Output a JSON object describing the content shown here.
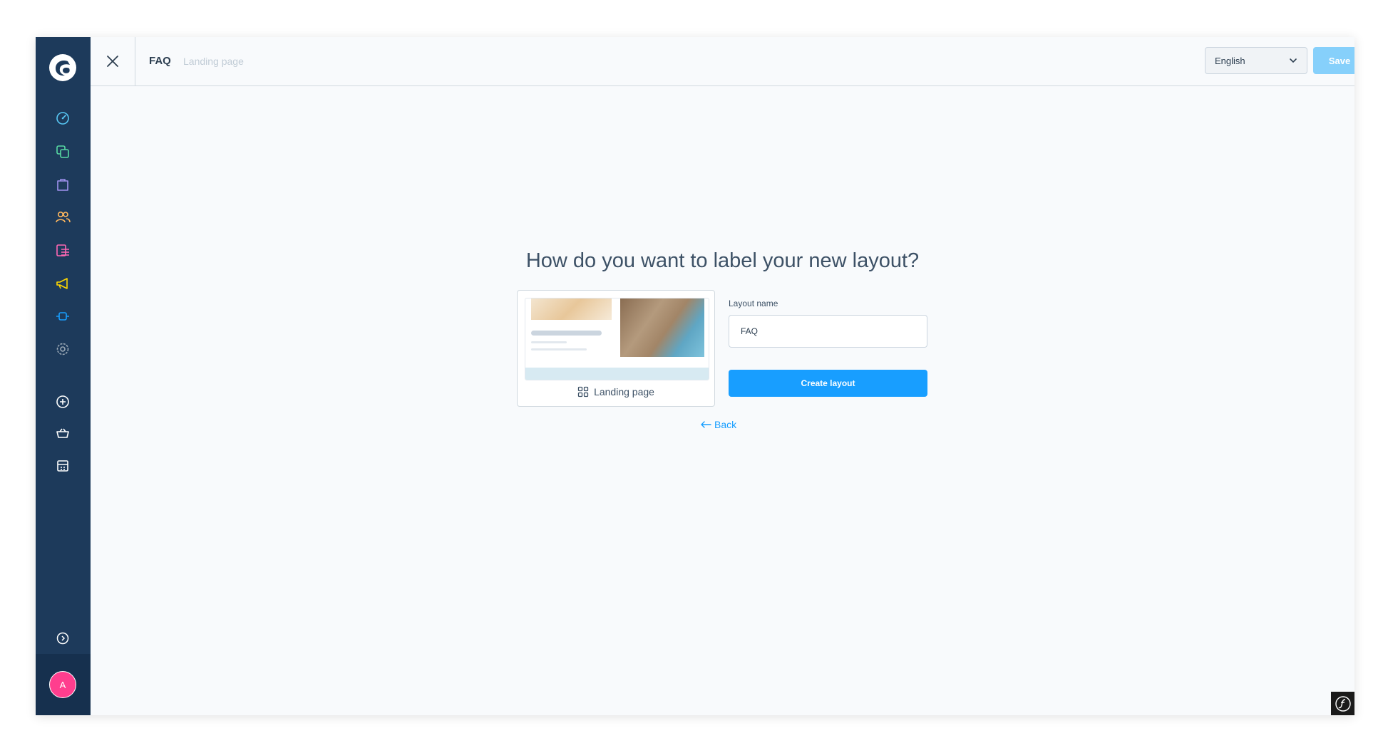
{
  "header": {
    "title": "FAQ",
    "subtitle": "Landing page",
    "language": "English",
    "save_label": "Save"
  },
  "sidebar": {
    "items": [
      {
        "icon": "dashboard-icon",
        "color": "#58c8f5"
      },
      {
        "icon": "catalogue-icon",
        "color": "#57d9a3"
      },
      {
        "icon": "orders-icon",
        "color": "#a092f0"
      },
      {
        "icon": "customers-icon",
        "color": "#ffb75d"
      },
      {
        "icon": "content-icon",
        "color": "#ff68b4"
      },
      {
        "icon": "marketing-icon",
        "color": "#ffd700"
      },
      {
        "icon": "extensions-icon",
        "color": "#189eff"
      },
      {
        "icon": "settings-icon",
        "color": "#9aa8b5"
      },
      {
        "icon": "add-icon",
        "color": "#ffffff"
      },
      {
        "icon": "sales-channel-basket-icon",
        "color": "#ffffff"
      },
      {
        "icon": "sales-channel-storefront-icon",
        "color": "#ffffff"
      },
      {
        "icon": "collapse-menu-icon",
        "color": "#ffffff"
      }
    ],
    "avatar_initial": "A"
  },
  "main": {
    "headline": "How do you want to label your new layout?",
    "preview_label": "Landing page",
    "field_label": "Layout name",
    "layout_name_value": "FAQ",
    "create_label": "Create layout",
    "back_label": "Back"
  },
  "colors": {
    "sidebar": "#1d3a5b",
    "primary": "#189eff",
    "save_disabled": "#86d0fb",
    "avatar": "#ff3e8e"
  }
}
